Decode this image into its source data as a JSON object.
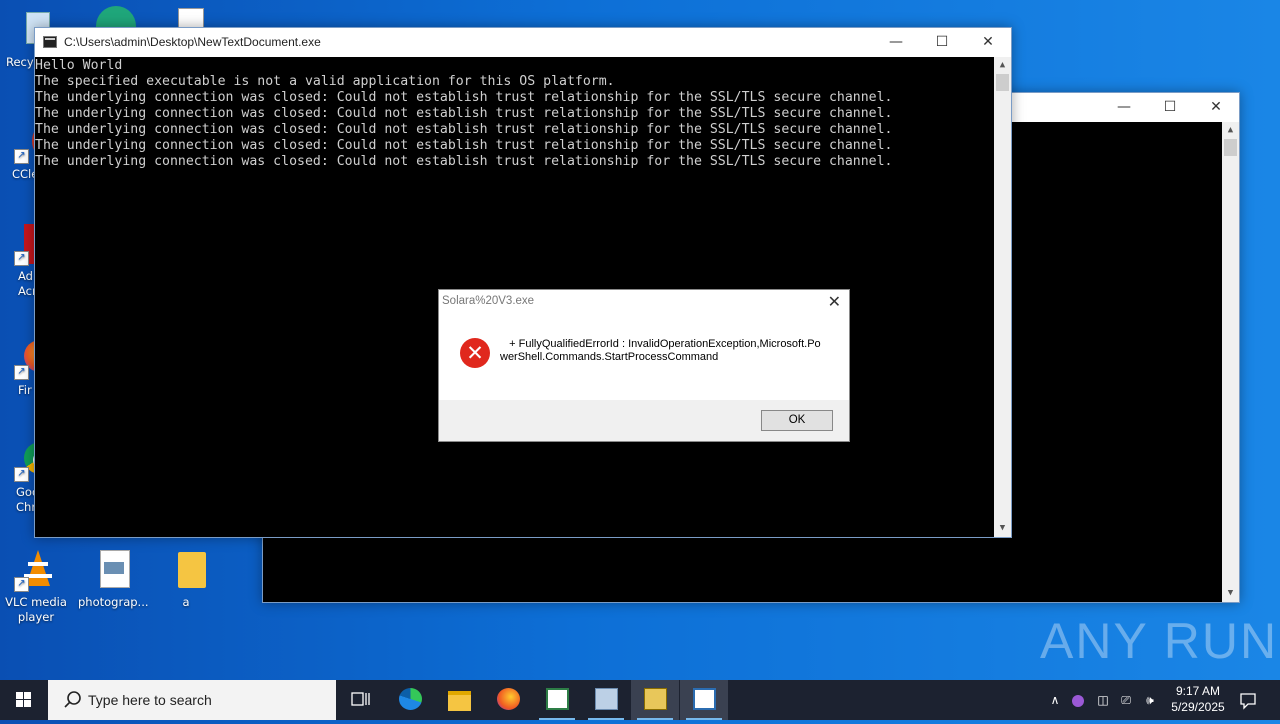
{
  "desktop": {
    "icons": [
      {
        "label": "Recy"
      },
      {
        "label": "CCle"
      },
      {
        "label": "Ad Acr"
      },
      {
        "label": "Fir"
      },
      {
        "label": "Goo Chr"
      },
      {
        "label": "VLC media player"
      },
      {
        "label": "photograp..."
      },
      {
        "label": "a"
      }
    ]
  },
  "console_window": {
    "title": "C:\\Users\\admin\\Desktop\\NewTextDocument.exe",
    "lines": "Hello World\nThe specified executable is not a valid application for this OS platform.\nThe underlying connection was closed: Could not establish trust relationship for the SSL/TLS secure channel.\nThe underlying connection was closed: Could not establish trust relationship for the SSL/TLS secure channel.\nThe underlying connection was closed: Could not establish trust relationship for the SSL/TLS secure channel.\nThe underlying connection was closed: Could not establish trust relationship for the SSL/TLS secure channel.\nThe underlying connection was closed: Could not establish trust relationship for the SSL/TLS secure channel."
  },
  "dialog": {
    "title": "Solara%20V3.exe",
    "message": "   + FullyQualifiedErrorId : InvalidOperationException,Microsoft.PowerShell.Commands.StartProcessCommand",
    "ok_label": "OK"
  },
  "watermark": "ANY RUN",
  "taskbar": {
    "search_placeholder": "Type here to search",
    "time": "9:17 AM",
    "date": "5/29/2025"
  }
}
